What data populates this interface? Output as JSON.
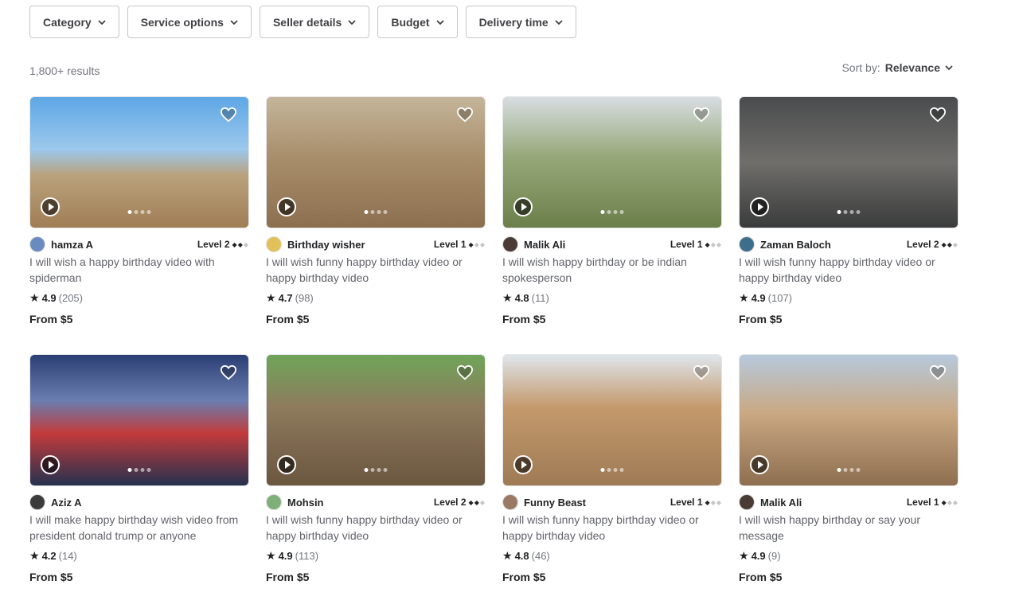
{
  "filters": [
    {
      "label": "Category"
    },
    {
      "label": "Service options"
    },
    {
      "label": "Seller details"
    },
    {
      "label": "Budget"
    },
    {
      "label": "Delivery time"
    }
  ],
  "results_count": "1,800+ results",
  "sort": {
    "label": "Sort by:",
    "value": "Relevance"
  },
  "gigs": [
    {
      "seller": "hamza A",
      "level": "Level 2",
      "level_num": 2,
      "title": "I will wish a happy birthday video with spiderman",
      "rating": "4.9",
      "reviews": "(205)",
      "price": "From $5"
    },
    {
      "seller": "Birthday wisher",
      "level": "Level 1",
      "level_num": 1,
      "title": "I will wish funny happy birthday video or happy birthday video",
      "rating": "4.7",
      "reviews": "(98)",
      "price": "From $5"
    },
    {
      "seller": "Malik Ali",
      "level": "Level 1",
      "level_num": 1,
      "title": "I will wish happy birthday or be indian spokesperson",
      "rating": "4.8",
      "reviews": "(11)",
      "price": "From $5"
    },
    {
      "seller": "Zaman Baloch",
      "level": "Level 2",
      "level_num": 2,
      "title": "I will wish funny happy birthday video or happy birthday video",
      "rating": "4.9",
      "reviews": "(107)",
      "price": "From $5"
    },
    {
      "seller": "Aziz A",
      "level": "",
      "level_num": 0,
      "title": "I will make happy birthday wish video from president donald trump or anyone",
      "rating": "4.2",
      "reviews": "(14)",
      "price": "From $5"
    },
    {
      "seller": "Mohsin",
      "level": "Level 2",
      "level_num": 2,
      "title": "I will wish funny happy birthday video or happy birthday video",
      "rating": "4.9",
      "reviews": "(113)",
      "price": "From $5"
    },
    {
      "seller": "Funny Beast",
      "level": "Level 1",
      "level_num": 1,
      "title": "I will wish funny happy birthday video or happy birthday video",
      "rating": "4.8",
      "reviews": "(46)",
      "price": "From $5"
    },
    {
      "seller": "Malik Ali",
      "level": "Level 1",
      "level_num": 1,
      "title": "I will wish happy birthday or say your message",
      "rating": "4.9",
      "reviews": "(9)",
      "price": "From $5"
    }
  ],
  "colors": {
    "text": "#404145",
    "muted": "#74767e",
    "border": "#c5c6c9"
  },
  "icons": {
    "chevron": "chevron-down-icon",
    "heart": "heart-icon",
    "play": "play-icon",
    "star": "star-icon"
  }
}
